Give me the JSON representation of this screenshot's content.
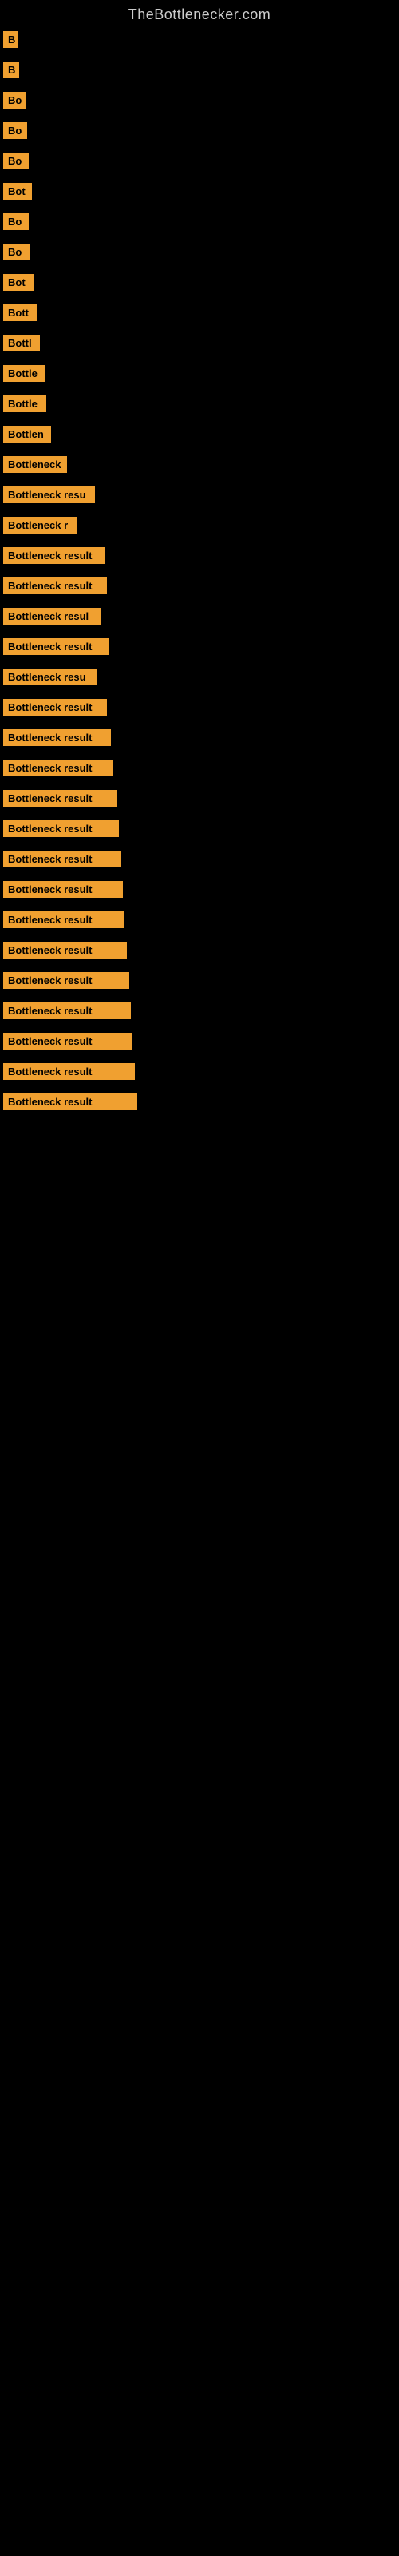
{
  "site_title": "TheBottlenecker.com",
  "rows": [
    {
      "label": "B",
      "width": 18
    },
    {
      "label": "B",
      "width": 20
    },
    {
      "label": "Bo",
      "width": 28
    },
    {
      "label": "Bo",
      "width": 30
    },
    {
      "label": "Bo",
      "width": 32
    },
    {
      "label": "Bot",
      "width": 36
    },
    {
      "label": "Bo",
      "width": 32
    },
    {
      "label": "Bo",
      "width": 34
    },
    {
      "label": "Bot",
      "width": 38
    },
    {
      "label": "Bott",
      "width": 42
    },
    {
      "label": "Bottl",
      "width": 46
    },
    {
      "label": "Bottle",
      "width": 52
    },
    {
      "label": "Bottle",
      "width": 54
    },
    {
      "label": "Bottlen",
      "width": 60
    },
    {
      "label": "Bottleneck",
      "width": 80
    },
    {
      "label": "Bottleneck resu",
      "width": 115
    },
    {
      "label": "Bottleneck r",
      "width": 92
    },
    {
      "label": "Bottleneck result",
      "width": 128
    },
    {
      "label": "Bottleneck result",
      "width": 130
    },
    {
      "label": "Bottleneck resul",
      "width": 122
    },
    {
      "label": "Bottleneck result",
      "width": 132
    },
    {
      "label": "Bottleneck resu",
      "width": 118
    },
    {
      "label": "Bottleneck result",
      "width": 130
    },
    {
      "label": "Bottleneck result",
      "width": 135
    },
    {
      "label": "Bottleneck result",
      "width": 138
    },
    {
      "label": "Bottleneck result",
      "width": 142
    },
    {
      "label": "Bottleneck result",
      "width": 145
    },
    {
      "label": "Bottleneck result",
      "width": 148
    },
    {
      "label": "Bottleneck result",
      "width": 150
    },
    {
      "label": "Bottleneck result",
      "width": 152
    },
    {
      "label": "Bottleneck result",
      "width": 155
    },
    {
      "label": "Bottleneck result",
      "width": 158
    },
    {
      "label": "Bottleneck result",
      "width": 160
    },
    {
      "label": "Bottleneck result",
      "width": 162
    },
    {
      "label": "Bottleneck result",
      "width": 165
    },
    {
      "label": "Bottleneck result",
      "width": 168
    }
  ]
}
